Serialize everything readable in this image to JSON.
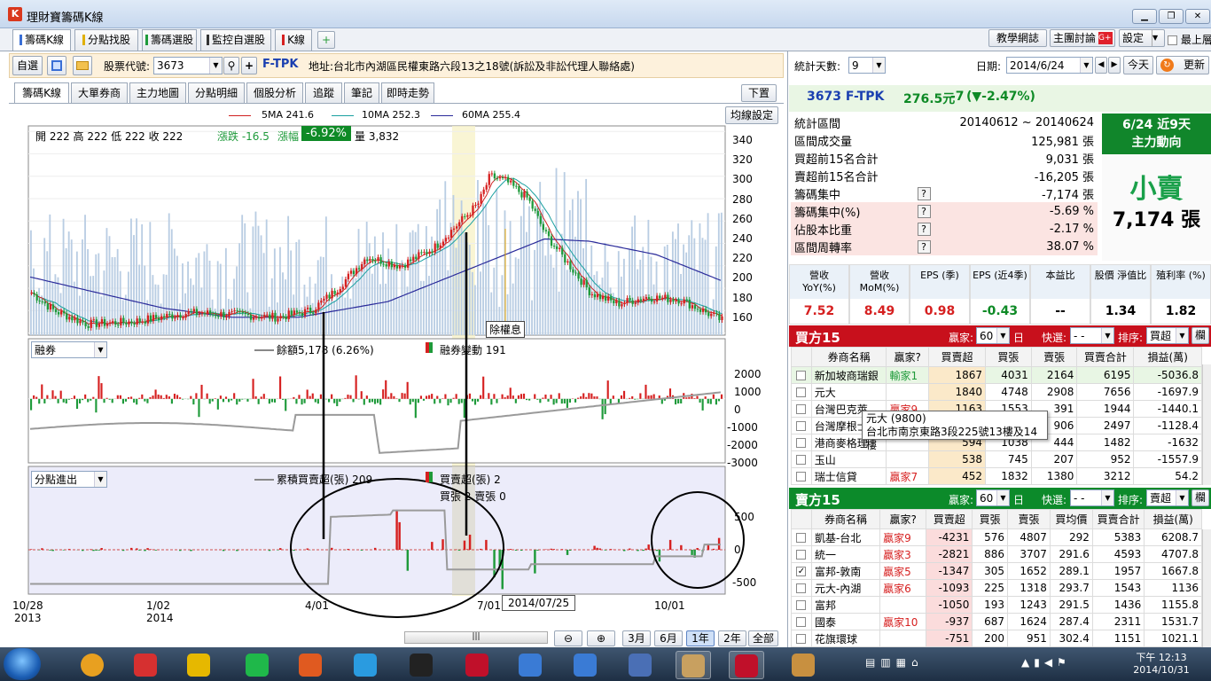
{
  "window": {
    "title": "理財寶籌碼K線",
    "app_icon": "K"
  },
  "window_controls": {
    "minimize": "▁",
    "restore": "❐",
    "close": "✕"
  },
  "top_tabs": [
    "籌碼K線",
    "分點找股",
    "籌碼選股",
    "監控自選股",
    "K線"
  ],
  "top_tab_colors": [
    "#3a6fd6",
    "#e0b000",
    "#1e9a3a",
    "#333333",
    "#d62020"
  ],
  "top_right": {
    "tutorial": "教學網誌",
    "forum": "主團討論",
    "settings": "設定",
    "maximize": "最上層"
  },
  "toolbar": {
    "self_select": "自選",
    "stock_code_label": "股票代號:",
    "stock_code": "3673",
    "stock_name": "F-TPK",
    "address": "地址:台北市內湖區民權東路六段13之18號(訴訟及非訟代理人聯絡處)"
  },
  "sub_tabs": [
    "籌碼K線",
    "大單券商",
    "主力地圖",
    "分點明細",
    "個股分析",
    "追蹤",
    "筆記",
    "即時走勢"
  ],
  "chart_header": {
    "down_btn": "下置",
    "ma_settings": "均線設定",
    "ma5": "5MA 241.6",
    "ma10": "10MA 252.3",
    "ma60": "60MA 255.4"
  },
  "ohlc": {
    "text": "開 222 高 222 低 222 收 222",
    "change": "漲跌 -16.5",
    "pct_label": "漲幅",
    "pct": "-6.92%",
    "volume": "量 3,832"
  },
  "price_axis": [
    "340",
    "320",
    "300",
    "280",
    "260",
    "240",
    "220",
    "200",
    "180",
    "160"
  ],
  "ex_dividend": "除權息",
  "margin_panel": {
    "select": "融券",
    "legend_balance": "餘額5,178 (6.26%)",
    "legend_change": "融券變動 191",
    "axis": [
      "2000",
      "1000",
      "0",
      "-1000",
      "-2000",
      "-3000"
    ]
  },
  "branch_panel": {
    "select": "分點進出",
    "legend_cum": "累積買賣超(張) 209",
    "legend_net": "買賣超(張) 2",
    "legend_sub": "買張 2 賣張 0",
    "axis": [
      "500",
      "0",
      "-500"
    ]
  },
  "x_axis": {
    "labels": [
      "10/28",
      "1/02",
      "4/01",
      "7/01",
      "10/01"
    ],
    "years": [
      "2013",
      "2014"
    ],
    "tooltip": "2014/07/25"
  },
  "range_buttons": [
    "3月",
    "6月",
    "1年",
    "2年",
    "全部"
  ],
  "stats": {
    "days_label": "統計天數:",
    "days": "9",
    "date_label": "日期:",
    "date": "2014/6/24",
    "today": "今天",
    "refresh": "更新",
    "headline": {
      "code": "3673 F-TPK",
      "price": "276.5元",
      "change": "-7",
      "pct": "(▼-2.47%)"
    },
    "rows": [
      {
        "label": "統計區間",
        "value": "20140612 ~ 20140624",
        "help": false
      },
      {
        "label": "區間成交量",
        "value": "125,981 張",
        "help": false
      },
      {
        "label": "買超前15名合計",
        "value": "9,031 張",
        "help": false
      },
      {
        "label": "賣超前15名合計",
        "value": "-16,205 張",
        "help": false
      },
      {
        "label": "籌碼集中",
        "value": "-7,174 張",
        "help": true
      },
      {
        "label": "籌碼集中(%)",
        "value": "-5.69 %",
        "help": true
      },
      {
        "label": "佔股本比重",
        "value": "-2.17 %",
        "help": true
      },
      {
        "label": "區間周轉率",
        "value": "38.07 %",
        "help": true
      }
    ],
    "trend_title": "6/24 近9天",
    "trend_sub": "主力動向",
    "trend_word": "小賣",
    "trend_amount": "7,174 張"
  },
  "fundamentals": {
    "headers": [
      "營收 YoY(%)",
      "營收 MoM(%)",
      "EPS (季)",
      "EPS (近4季)",
      "本益比",
      "股價 淨值比",
      "殖利率 (%)"
    ],
    "values": [
      "7.52",
      "8.49",
      "0.98",
      "-0.43",
      "--",
      "1.34",
      "1.82"
    ]
  },
  "buy_panel": {
    "title": "買方15",
    "winner_label": "贏家:",
    "winner_value": "60",
    "day": "日",
    "quick": "快選:",
    "quick_value": "- -",
    "sort": "排序:",
    "sort_value": "買超",
    "lock": "欄",
    "columns": [
      "券商名稱",
      "贏家?",
      "買賣超",
      "買張",
      "賣張",
      "買賣合計",
      "損益(萬)"
    ],
    "rows": [
      [
        "新加坡商瑞銀",
        "輸家1",
        "1867",
        "4031",
        "2164",
        "6195",
        "-5036.8"
      ],
      [
        "元大",
        "",
        "1840",
        "4748",
        "2908",
        "7656",
        "-1697.9"
      ],
      [
        "台灣巴克萊",
        "贏家9",
        "1163",
        "1553",
        "391",
        "1944",
        "-1440.1"
      ],
      [
        "台灣摩根士",
        "",
        "685",
        "1591",
        "906",
        "2497",
        "-1128.4"
      ],
      [
        "港商麥格理",
        "",
        "594",
        "1038",
        "444",
        "1482",
        "-1632"
      ],
      [
        "玉山",
        "",
        "538",
        "745",
        "207",
        "952",
        "-1557.9"
      ],
      [
        "瑞士信貸",
        "贏家7",
        "452",
        "1832",
        "1380",
        "3212",
        "54.2"
      ]
    ]
  },
  "tooltip": {
    "line1": "元大 (9800)",
    "line2": "台北市南京東路3段225號13樓及14樓"
  },
  "sell_panel": {
    "title": "賣方15",
    "winner_label": "贏家:",
    "winner_value": "60",
    "day": "日",
    "quick": "快選:",
    "quick_value": "- -",
    "sort": "排序:",
    "sort_value": "賣超",
    "lock": "欄",
    "columns": [
      "券商名稱",
      "贏家?",
      "買賣超",
      "買張",
      "賣張",
      "買均價",
      "買賣合計",
      "損益(萬)"
    ],
    "rows": [
      [
        "凱基-台北",
        "贏家9",
        "-4231",
        "576",
        "4807",
        "292",
        "5383",
        "6208.7"
      ],
      [
        "統一",
        "贏家3",
        "-2821",
        "886",
        "3707",
        "291.6",
        "4593",
        "4707.8"
      ],
      [
        "富邦-敦南",
        "贏家5",
        "-1347",
        "305",
        "1652",
        "289.1",
        "1957",
        "1667.8"
      ],
      [
        "元大-內湖",
        "贏家6",
        "-1093",
        "225",
        "1318",
        "293.7",
        "1543",
        "1136"
      ],
      [
        "富邦",
        "",
        "-1050",
        "193",
        "1243",
        "291.5",
        "1436",
        "1155.8"
      ],
      [
        "國泰",
        "贏家10",
        "-937",
        "687",
        "1624",
        "287.4",
        "2311",
        "1531.7"
      ],
      [
        "花旗環球",
        "",
        "-751",
        "200",
        "951",
        "302.4",
        "1151",
        "1021.1"
      ]
    ]
  },
  "taskbar": {
    "time": "下午 12:13",
    "date": "2014/10/31"
  }
}
